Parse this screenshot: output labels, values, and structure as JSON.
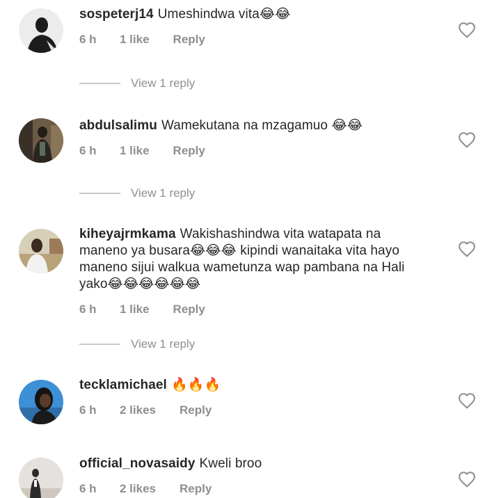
{
  "comments": [
    {
      "username": "sospeterj14",
      "text": "Umeshindwa vita😂😂",
      "time": "6 h",
      "likes": "1 like",
      "reply": "Reply",
      "view_replies": "View 1 reply",
      "avatar_colors": [
        "#e8e8e8",
        "#1c1c1c"
      ]
    },
    {
      "username": "abdulsalimu",
      "text": "Wamekutana na mzagamuo 😂😂",
      "time": "6 h",
      "likes": "1 like",
      "reply": "Reply",
      "view_replies": "View 1 reply",
      "avatar_colors": [
        "#5a4a3a",
        "#2a2520"
      ]
    },
    {
      "username": "kiheyajrmkama",
      "text": "Wakishashindwa vita watapata na maneno ya busara😂😂😂 kipindi wanaitaka vita hayo maneno sijui walkua wametunza wap pambana na Hali yako😂😂😂😂😂😂",
      "time": "6 h",
      "likes": "1 like",
      "reply": "Reply",
      "view_replies": "View 1 reply",
      "avatar_colors": [
        "#cdbb93",
        "#3b2a22"
      ]
    },
    {
      "username": "tecklamichael",
      "text": "🔥🔥🔥",
      "time": "6 h",
      "likes": "2 likes",
      "reply": "Reply",
      "avatar_colors": [
        "#3d8fd6",
        "#141414"
      ]
    },
    {
      "username": "official_novasaidy",
      "text": "Kweli broo",
      "time": "6 h",
      "likes": "2 likes",
      "reply": "Reply",
      "avatar_colors": [
        "#e5e1dc",
        "#2b2b2b"
      ]
    }
  ],
  "icons": {
    "like": "heart-icon"
  },
  "colors": {
    "text": "#262626",
    "secondary": "#8e8e8e",
    "divider": "#c7c7c7"
  }
}
